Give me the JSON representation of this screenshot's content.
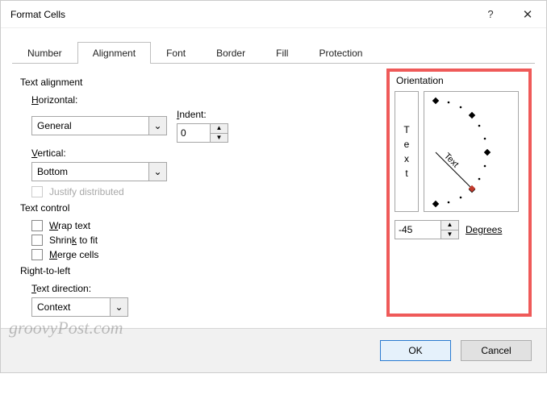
{
  "title": "Format Cells",
  "tabs": [
    "Number",
    "Alignment",
    "Font",
    "Border",
    "Fill",
    "Protection"
  ],
  "active_tab": "Alignment",
  "sections": {
    "text_alignment": {
      "title": "Text alignment",
      "horizontal_label": "Horizontal:",
      "horizontal_value": "General",
      "indent_label": "Indent:",
      "indent_value": "0",
      "vertical_label": "Vertical:",
      "vertical_value": "Bottom",
      "justify_label": "Justify distributed"
    },
    "text_control": {
      "title": "Text control",
      "wrap": "Wrap text",
      "shrink": "Shrink to fit",
      "merge": "Merge cells"
    },
    "rtl": {
      "title": "Right-to-left",
      "text_direction_label": "Text direction:",
      "text_direction_value": "Context"
    },
    "orientation": {
      "title": "Orientation",
      "vertical_text": [
        "T",
        "e",
        "x",
        "t"
      ],
      "arc_label": "Text",
      "degrees_value": "-45",
      "degrees_label": "Degrees"
    }
  },
  "buttons": {
    "ok": "OK",
    "cancel": "Cancel"
  },
  "watermark": "groovyPost.com",
  "chevron": "⌄",
  "up": "▲",
  "down": "▼",
  "help": "?",
  "close": "✕"
}
